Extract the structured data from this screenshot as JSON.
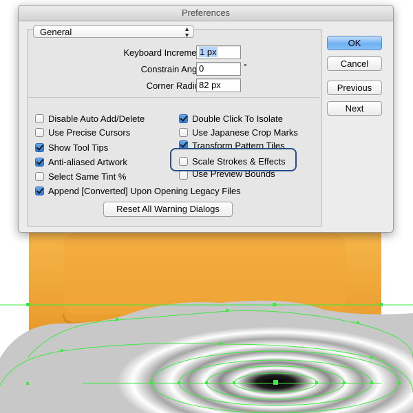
{
  "window": {
    "title": "Preferences"
  },
  "category": {
    "selected": "General"
  },
  "fields": [
    {
      "label": "Keyboard Increment:",
      "value": "1 px",
      "unit": ""
    },
    {
      "label": "Constrain Angle:",
      "value": "0",
      "unit": "°"
    },
    {
      "label": "Corner Radius:",
      "value": "82 px",
      "unit": ""
    }
  ],
  "left_options": [
    {
      "label": "Disable Auto Add/Delete",
      "checked": false
    },
    {
      "label": "Use Precise Cursors",
      "checked": false
    },
    {
      "label": "Show Tool Tips",
      "checked": true
    },
    {
      "label": "Anti-aliased Artwork",
      "checked": true
    },
    {
      "label": "Select Same Tint %",
      "checked": false
    }
  ],
  "right_options": [
    {
      "label": "Double Click To Isolate",
      "checked": true
    },
    {
      "label": "Use Japanese Crop Marks",
      "checked": false
    },
    {
      "label": "Transform Pattern Tiles",
      "checked": true
    },
    {
      "label": "Scale Strokes & Effects",
      "checked": false
    },
    {
      "label": "Use Preview Bounds",
      "checked": false
    }
  ],
  "wide_option": {
    "label": "Append [Converted] Upon Opening Legacy Files",
    "checked": true
  },
  "reset_button": "Reset All Warning Dialogs",
  "buttons": {
    "ok": "OK",
    "cancel": "Cancel",
    "previous": "Previous",
    "next": "Next"
  },
  "colors": {
    "accent": "#244f86",
    "default_button": "#6fb1f3",
    "artwork_orange": "#f0a12e",
    "artwork_dark": "#231f20",
    "selection_green": "#3ee83e"
  }
}
